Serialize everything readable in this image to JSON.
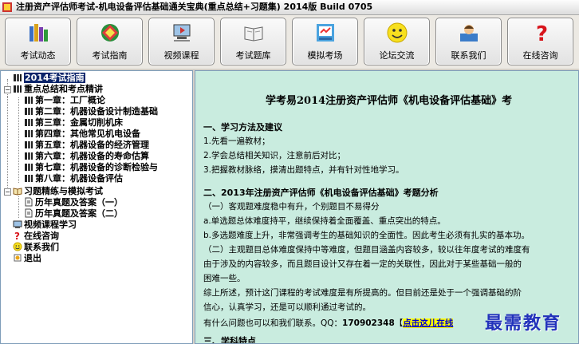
{
  "window": {
    "title": "注册资产评估师考试-机电设备评估基础通关宝典(重点总结+习题集) 2014版 Build 0705"
  },
  "toolbar": [
    {
      "label": "考试动态",
      "icon": "books-icon"
    },
    {
      "label": "考试指南",
      "icon": "compass-icon"
    },
    {
      "label": "视频课程",
      "icon": "video-icon"
    },
    {
      "label": "考试题库",
      "icon": "book-icon"
    },
    {
      "label": "模拟考场",
      "icon": "exam-icon"
    },
    {
      "label": "论坛交流",
      "icon": "smiley-icon"
    },
    {
      "label": "联系我们",
      "icon": "contact-icon"
    },
    {
      "label": "在线咨询",
      "icon": "question-icon"
    }
  ],
  "tree": {
    "root": "2014考试指南",
    "summary": "重点总结和考点精讲",
    "chapters": [
      "第一章：工厂概论",
      "第二章：机器设备设计制造基础",
      "第三章：金属切削机床",
      "第四章：其他常见机电设备",
      "第五章：机器设备的经济管理",
      "第六章：机器设备的寿命估算",
      "第七章：机器设备的诊断检验与",
      "第八章：机器设备评估"
    ],
    "practice": "习题精练与模拟考试",
    "practice_items": [
      "历年真题及答案（一）",
      "历年真题及答案（二）"
    ],
    "video": "视频课程学习",
    "consult": "在线咨询",
    "contact": "联系我们",
    "exit": "退出"
  },
  "content": {
    "title": "学考易2014注册资产评估师《机电设备评估基础》考",
    "s1": "一、学习方法及建议",
    "l1": "1.先看一遍教材；",
    "l2": "2.学会总结相关知识，注意前后对比；",
    "l3": "3.把握教材脉络，摸清出题特点，并有针对性地学习。",
    "s2": "二、2013年注册资产评估师《机电设备评估基础》考题分析",
    "l4": "（一）客观题难度稳中有升，个别题目不易得分",
    "l5": "a.单选题总体难度持平，继续保持着全面覆盖、重点突出的特点。",
    "l6": "b.多选题难度上升，非常强调考生的基础知识的全面性。因此考生必须有扎实的基本功。",
    "l7": "（二）主观题目总体难度保持中等难度，但题目涵盖内容较多，较以往年度考试的难度有",
    "l8": "由于涉及的内容较多，而且题目设计又存在着一定的关联性，因此对于某些基础一般的",
    "l9": "困难一些。",
    "l10": "综上所述，预计这门课程的考试难度是有所提高的。但目前还是处于一个强调基础的阶",
    "l11": "信心，认真学习，还是可以顺利通过考试的。",
    "l12a": "有什么问题也可以和我们联系。QQ：",
    "qq": "170902348",
    "bracket": "【",
    "link": "点击这儿在线",
    "l13": "三、学科特点"
  },
  "watermark": "最需教育"
}
